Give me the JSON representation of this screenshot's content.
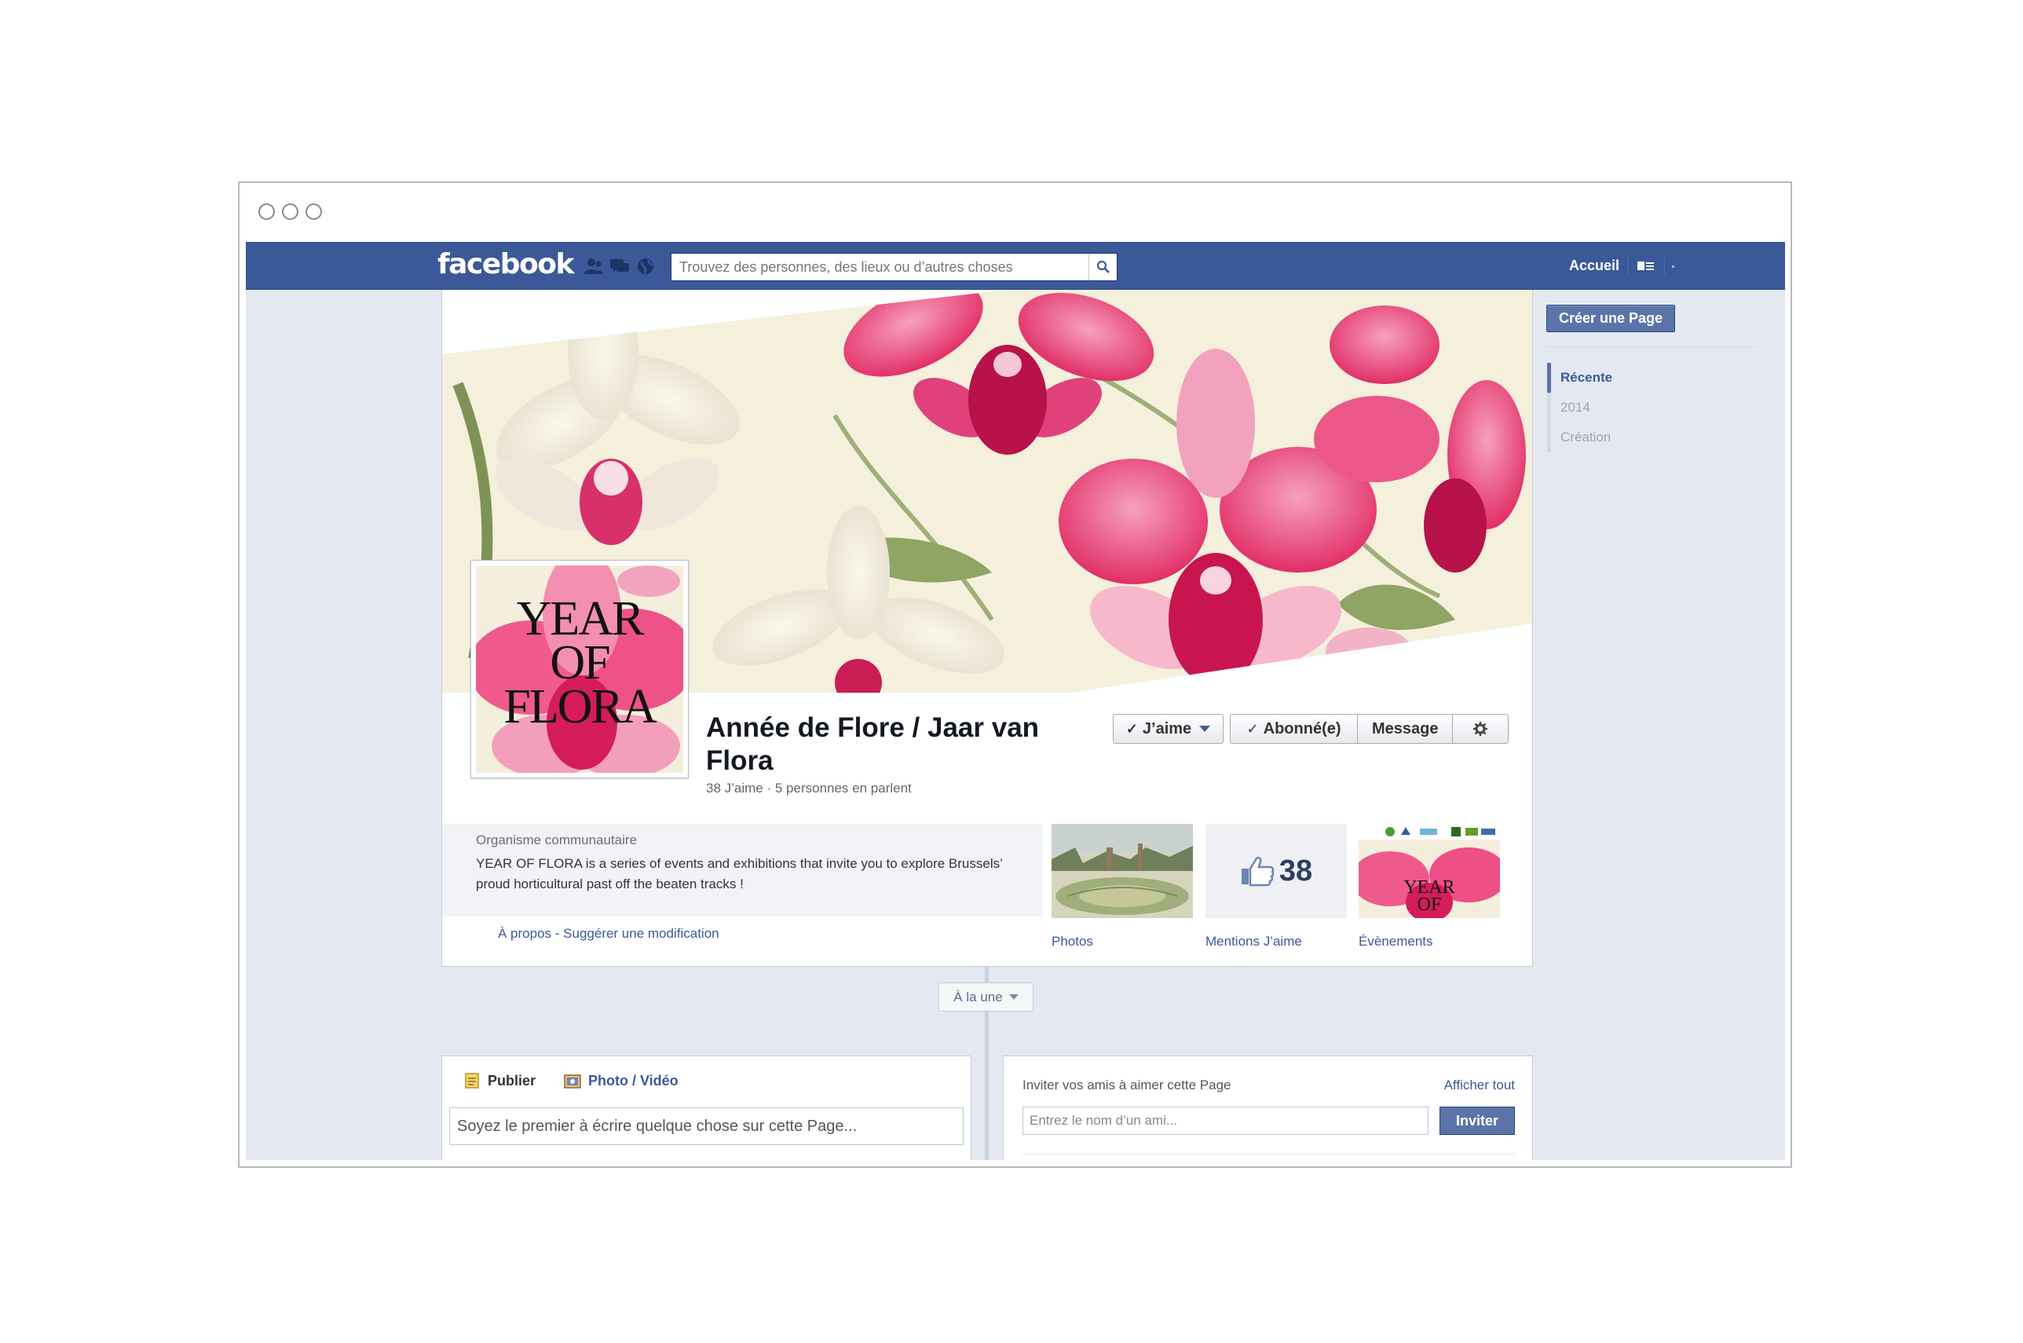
{
  "topbar": {
    "logo": "facebook",
    "search_placeholder": "Trouvez des personnes, des lieux ou d’autres choses",
    "home_label": "Accueil"
  },
  "page": {
    "name": "Année de Flore / Jaar van Flora",
    "stats": "38 J’aime · 5 personnes en parlent",
    "profile_lines": [
      "YEAR",
      "OF",
      "FLORA"
    ],
    "buttons": {
      "like": "J’aime",
      "subscribed": "Abonné(e)",
      "message": "Message"
    },
    "about": {
      "category": "Organisme communautaire",
      "description": "YEAR OF FLORA is a series of events and exhibitions that invite you to explore Brussels’ proud horticultural past off the beaten tracks !",
      "links": "À propos  -  Suggérer une modification"
    },
    "tiles": {
      "photos": "Photos",
      "likes_count": "38",
      "likes_label": "Mentions J’aime",
      "events": "Évènements"
    }
  },
  "sidebar": {
    "create_page": "Créer une Page",
    "timeline_items": [
      {
        "label": "Récente",
        "active": true
      },
      {
        "label": "2014",
        "active": false
      },
      {
        "label": "Création",
        "active": false
      }
    ]
  },
  "timeline": {
    "highlights_label": "À la une"
  },
  "composer": {
    "tab_publish": "Publier",
    "tab_photo": "Photo / Vidéo",
    "placeholder": "Soyez le premier à écrire quelque chose sur cette Page..."
  },
  "invite": {
    "label": "Inviter vos amis à aimer cette Page",
    "see_all": "Afficher tout",
    "placeholder": "Entrez le nom d’un ami...",
    "button": "Inviter"
  },
  "colors": {
    "brand_blue": "#3b5998",
    "orchid_pink": "#e8336e",
    "cream": "#f3efd8"
  }
}
